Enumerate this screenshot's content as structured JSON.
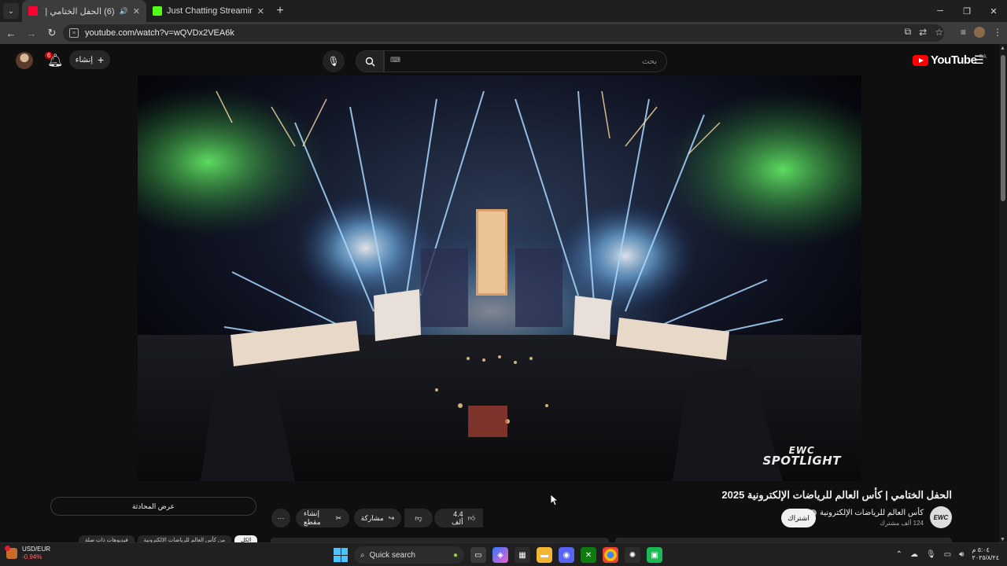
{
  "browser": {
    "tabs": [
      {
        "title": "(6) الحفل الختامي | كأس العال",
        "active": true,
        "favicon_color": "#ff0033"
      },
      {
        "title": "Just Chatting Streaming - Live",
        "active": false,
        "favicon_color": "#53fc18"
      }
    ],
    "new_tab_label": "+",
    "url": "youtube.com/watch?v=wQVDx2VEA6k",
    "icons": [
      "tab-list-icon",
      "back-icon",
      "forward-icon",
      "reload-icon",
      "site-info-icon",
      "cast-icon",
      "translate-icon",
      "star-icon",
      "reading-list-icon",
      "profile-icon",
      "menu-icon"
    ],
    "window_controls": {
      "minimize": "─",
      "maximize": "❐",
      "close": "✕"
    }
  },
  "youtube": {
    "header": {
      "notification_count": "6",
      "create_label": "إنشاء",
      "search_placeholder": "بحث",
      "logo_text": "YouTube",
      "country_code": "SA"
    },
    "video": {
      "title": "الحفل الختامي | كأس العالم للرياضات الإلكترونية 2025",
      "watermark_line1": "EWC",
      "watermark_line2": "SPOTLIGHT"
    },
    "channel": {
      "name": "كأس العالم للرياضات الإلكترونية",
      "subscribers": "124 ألف مشترك",
      "logo_text": "EWC",
      "subscribe_label": "اشتراك"
    },
    "actions": {
      "like_count": "4.4 ألف",
      "share_label": "مشاركة",
      "clip_label": "إنشاء مقطع",
      "more_label": "···",
      "chat_label": "عرض المحادثة"
    },
    "chips": [
      "الكل",
      "من كأس العالم للرياضات الإلكترونية",
      "فيديوهات ذات صلة"
    ]
  },
  "taskbar": {
    "ticker_name": "USD/EUR",
    "ticker_change": "-0.94%",
    "search_label": "Quick search",
    "apps": [
      "file-explorer",
      "copilot",
      "store",
      "folder",
      "discord",
      "xbox",
      "chrome",
      "chatgpt",
      "app"
    ],
    "clock_time": "٥:٠٤ م",
    "clock_date": "٢٠٢٥/٨/٢٤"
  }
}
